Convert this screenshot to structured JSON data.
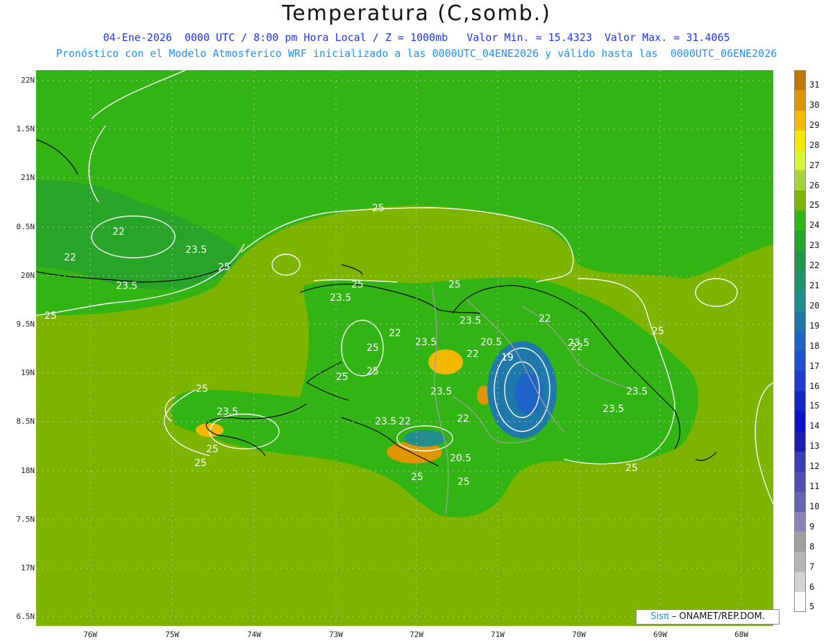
{
  "title": "Temperatura (C,somb.)",
  "subtitle_line1": "04-Ene-2026  0000 UTC / 8:00 pm Hora Local / Z = 1000mb   Valor Min. = 15.4323  Valor Max. = 31.4065",
  "subtitle_line2": "Pronóstico con el Modelo Atmosferico WRF inicializado a las 0000UTC_04ENE2026 y válido hasta las  0000UTC_06ENE2026",
  "credit": {
    "logo": "Sisπ",
    "text": " – ONAMET/REP.DOM."
  },
  "lat_labels": [
    "22N",
    "1.5N",
    "21N",
    "0.5N",
    "20N",
    "9.5N",
    "19N",
    "8.5N",
    "18N",
    "7.5N",
    "17N",
    "6.5N"
  ],
  "lon_labels": [
    "76W",
    "75W",
    "74W",
    "73W",
    "72W",
    "71W",
    "70W",
    "69W",
    "68W"
  ],
  "colorbar_labels": [
    "31",
    "30",
    "29",
    "28",
    "27",
    "26",
    "25",
    "24",
    "23",
    "22",
    "21",
    "20",
    "19",
    "18",
    "17",
    "16",
    "15",
    "14",
    "13",
    "12",
    "11",
    "10",
    "9",
    "8",
    "7",
    "6",
    "5"
  ],
  "colorbar_colors": [
    "#c07800",
    "#e09400",
    "#f5b800",
    "#f5e800",
    "#d6f53a",
    "#a8d23a",
    "#7db400",
    "#32b414",
    "#28a428",
    "#23964b",
    "#23916e",
    "#238c8c",
    "#1e78aa",
    "#1e64c8",
    "#1e50d2",
    "#1e3cd2",
    "#1428c8",
    "#0a14c8",
    "#1e1eb4",
    "#3c3cb4",
    "#5050b4",
    "#6464b4",
    "#8c82b9",
    "#a0a0a0",
    "#b4b4b4",
    "#d2d2d2",
    "#ffffff"
  ],
  "contour_labels": [
    "25",
    "25",
    "25",
    "25",
    "25",
    "25",
    "25",
    "25",
    "25",
    "25",
    "25",
    "25",
    "25",
    "25",
    "25",
    "23.5",
    "23.5",
    "23.5",
    "23.5",
    "23.5",
    "23.5",
    "23.5",
    "23.5",
    "23.5",
    "23.5",
    "23.5",
    "22",
    "22",
    "22",
    "22",
    "22",
    "22",
    "22",
    "22",
    "20.5",
    "20.5",
    "19"
  ],
  "colors": {
    "sea_green": "#7db400",
    "land_green": "#32b414",
    "contour": "#ffffff",
    "coast": "#000000",
    "border": "#a0a0a0",
    "title_blue": "#1a33ff",
    "subtitle_blue": "#1e90ff"
  }
}
